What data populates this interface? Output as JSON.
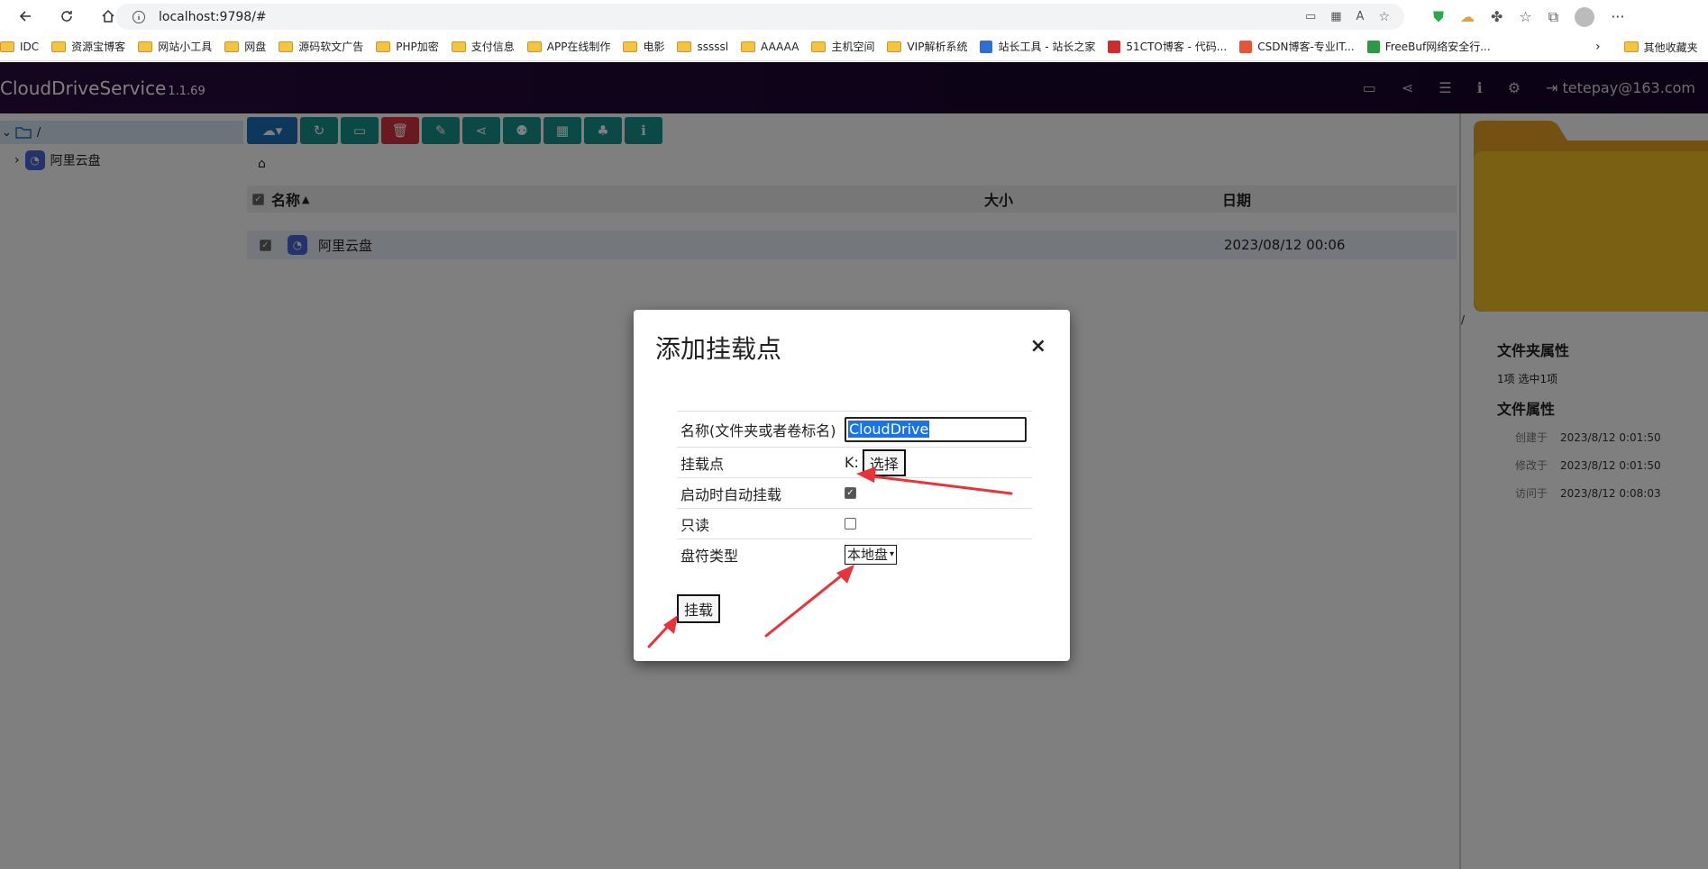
{
  "browser": {
    "url": "localhost:9798/#",
    "bookmarks": [
      "IDC",
      "资源宝博客",
      "网站小工具",
      "网盘",
      "源码软文广告",
      "PHP加密",
      "支付信息",
      "APP在线制作",
      "电影",
      "sssssl",
      "AAAAA",
      "主机空间",
      "VIP解析系统",
      "站长工具 - 站长之家",
      "51CTO博客 - 代码...",
      "CSDN博客-专业IT...",
      "FreeBuf网络安全行..."
    ],
    "other_bookmarks": "其他收藏夹"
  },
  "app": {
    "name": "CloudDriveService",
    "version": "1.1.69",
    "user": "tetepay@163.com"
  },
  "tree": {
    "root": "/",
    "items": [
      "阿里云盘"
    ]
  },
  "file_list": {
    "columns": {
      "name": "名称",
      "size": "大小",
      "date": "日期"
    },
    "rows": [
      {
        "name": "阿里云盘",
        "size": "",
        "date": "2023/08/12 00:06"
      }
    ]
  },
  "details": {
    "path": "/",
    "folder_props_title": "文件夹属性",
    "folder_props": "1项  选中1项",
    "file_props_title": "文件属性",
    "created_label": "创建于",
    "created": "2023/8/12 0:01:50",
    "modified_label": "修改于",
    "modified": "2023/8/12 0:01:50",
    "accessed_label": "访问于",
    "accessed": "2023/8/12 0:08:03"
  },
  "dialog": {
    "title": "添加挂载点",
    "close": "×",
    "name_label": "名称(文件夹或者卷标名)",
    "name_value": "CloudDrive",
    "mount_label": "挂载点",
    "mount_value": "K:",
    "pick_button": "选择",
    "auto_mount_label": "启动时自动挂载",
    "auto_mount": true,
    "readonly_label": "只读",
    "readonly": false,
    "drive_type_label": "盘符类型",
    "drive_type_value": "本地盘",
    "mount_button": "挂载"
  },
  "colors": {
    "toolbar_teal": "#17928f",
    "delete_red": "#d63342",
    "cloud_blue": "#1d6fb8",
    "annotation_red": "#e8333a",
    "folder_yellow": "#f4c127"
  }
}
